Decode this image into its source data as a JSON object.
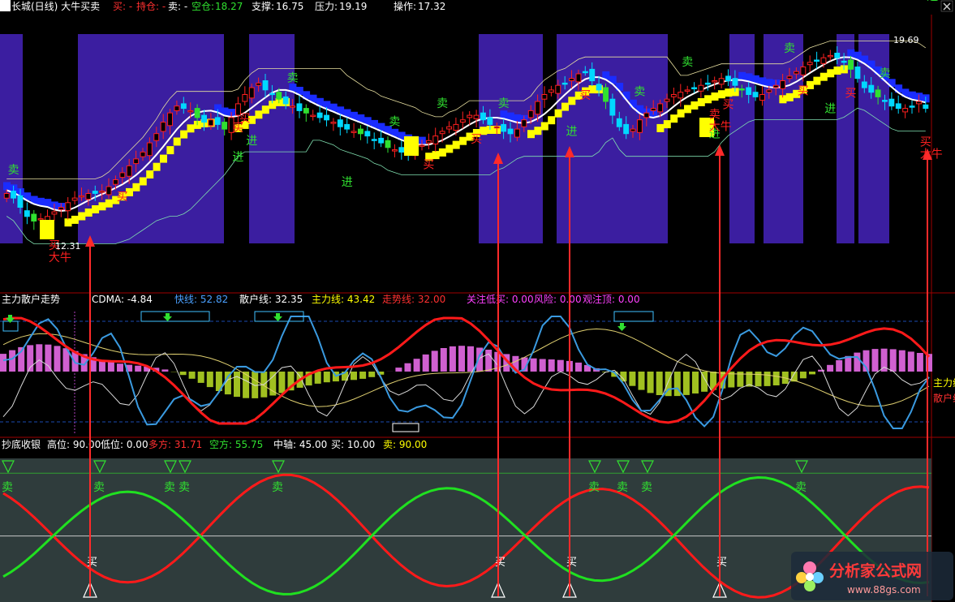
{
  "colors": {
    "up": "#ff2020",
    "down": "#00d8ff",
    "green": "#30e030",
    "yellow": "#ffff00",
    "blue": "#1a2cff",
    "purple": "#3b1ea0",
    "white": "#ffffff",
    "magenta": "#ff40ff",
    "divider": "#a00000",
    "pink": "#d060d0",
    "olive": "#a0c020",
    "panel3_bg": "#2f3c3c"
  },
  "header1": {
    "title": "深长城(日线) 大牛买卖",
    "buy": "买: -",
    "hold": "持仓: -",
    "sell": "卖: -",
    "empty_label": "空仓:",
    "empty_value": "18.27",
    "support_label": "支撑:",
    "support_value": "16.75",
    "pressure_label": "压力:",
    "pressure_value": "19.19",
    "op_label": "操作:",
    "op_value": "17.32"
  },
  "header2": {
    "title": "主力散户走势",
    "cdma": "CDMA: -4.84",
    "fast": "快线: 52.82",
    "retail": "散户线: 32.35",
    "main": "主力线: 43.42",
    "trend": "走势线: 32.00",
    "watch_low": "关注低买: 0.00",
    "risk": "风险: 0.00",
    "watch_top": "观注顶: 0.00"
  },
  "header3": {
    "title": "抄底收银",
    "high": "高位: 90.00",
    "low": "低位: 0.00",
    "long": "多方: 31.71",
    "short": "空方: 55.75",
    "axis": "中轴: 45.00",
    "buy": "买: 10.00",
    "sell": "卖: 90.00"
  },
  "panel2_right_labels": [
    "主力线",
    "散户线"
  ],
  "watermark": {
    "name": "分析家公式网",
    "url": "www.88gs.com"
  },
  "chart_data": [
    {
      "type": "candlestick",
      "title": "深长城(日线) 大牛买卖",
      "price_labels": {
        "high": "19.69",
        "low": "12.31"
      },
      "ylim": [
        11.5,
        20.6
      ],
      "sessions": 136,
      "closes": [
        13.6,
        13.4,
        13.0,
        12.6,
        12.4,
        12.5,
        12.6,
        12.8,
        13.0,
        13.2,
        13.4,
        13.5,
        13.6,
        13.6,
        13.7,
        13.9,
        14.2,
        14.5,
        14.8,
        15.1,
        15.4,
        15.8,
        16.2,
        16.7,
        17.1,
        17.4,
        17.3,
        17.2,
        16.9,
        16.7,
        16.8,
        16.6,
        16.4,
        16.9,
        17.5,
        17.9,
        18.2,
        18.4,
        18.1,
        17.9,
        17.7,
        17.5,
        17.4,
        17.2,
        17.1,
        17.0,
        16.9,
        16.8,
        16.7,
        16.5,
        16.4,
        16.3,
        16.2,
        16.1,
        15.9,
        15.8,
        15.6,
        15.5,
        15.4,
        15.4,
        15.6,
        15.7,
        15.9,
        16.1,
        16.3,
        16.5,
        16.6,
        16.8,
        17.0,
        17.0,
        16.8,
        16.6,
        16.5,
        16.3,
        16.2,
        16.4,
        16.8,
        17.2,
        17.6,
        17.9,
        18.1,
        18.3,
        18.4,
        18.6,
        18.8,
        18.9,
        18.5,
        18.1,
        17.6,
        17.0,
        16.5,
        16.2,
        16.4,
        16.8,
        17.1,
        17.3,
        17.5,
        17.7,
        17.9,
        18.0,
        18.1,
        18.2,
        18.3,
        18.4,
        18.5,
        18.6,
        18.5,
        18.3,
        18.1,
        17.9,
        17.8,
        17.9,
        18.1,
        18.3,
        18.5,
        18.7,
        18.9,
        19.1,
        19.3,
        19.4,
        19.5,
        19.6,
        19.5,
        19.3,
        19.0,
        18.6,
        18.2,
        18.0,
        17.8,
        17.6,
        17.4,
        17.3,
        17.3,
        17.4,
        17.6,
        17.3
      ],
      "signals": {
        "buy": [
          {
            "i": 17,
            "label": "买"
          },
          {
            "i": 34,
            "label": "买"
          },
          {
            "i": 35,
            "label": "买"
          },
          {
            "i": 62,
            "label": "买"
          },
          {
            "i": 69,
            "label": "买"
          },
          {
            "i": 85,
            "label": "买"
          },
          {
            "i": 106,
            "label": "买"
          },
          {
            "i": 117,
            "label": "买"
          },
          {
            "i": 124,
            "label": "买"
          }
        ],
        "sell": [
          {
            "i": 1,
            "label": "卖"
          },
          {
            "i": 42,
            "label": "卖"
          },
          {
            "i": 57,
            "label": "卖"
          },
          {
            "i": 64,
            "label": "卖"
          },
          {
            "i": 73,
            "label": "卖"
          },
          {
            "i": 93,
            "label": "卖"
          },
          {
            "i": 100,
            "label": "卖"
          },
          {
            "i": 115,
            "label": "卖"
          },
          {
            "i": 129,
            "label": "卖"
          },
          {
            "i": 140,
            "label": "卖"
          }
        ],
        "enter": [
          {
            "i": 34,
            "label": "进"
          },
          {
            "i": 36,
            "label": "进"
          },
          {
            "i": 50,
            "label": "进"
          },
          {
            "i": 83,
            "label": "进"
          },
          {
            "i": 104,
            "label": "进"
          },
          {
            "i": 121,
            "label": "进"
          },
          {
            "i": 136,
            "label": "进"
          }
        ],
        "bull": [
          {
            "i": 7,
            "label": "买\n大牛"
          },
          {
            "i": 104,
            "label": "卖\n大牛"
          },
          {
            "i": 135,
            "label": "买\n大牛"
          }
        ]
      }
    },
    {
      "type": "line",
      "title": "主力散户走势",
      "ylim": [
        -60,
        60
      ],
      "series": [
        {
          "name": "快线",
          "values": [
            52.82
          ]
        },
        {
          "name": "散户线",
          "values": [
            32.35
          ]
        },
        {
          "name": "主力线",
          "values": [
            43.42
          ]
        },
        {
          "name": "走势线",
          "values": [
            32.0
          ]
        }
      ]
    },
    {
      "type": "line",
      "title": "抄底收银",
      "ylim": [
        0,
        100
      ],
      "series": [
        {
          "name": "多方",
          "values": [
            31.71
          ]
        },
        {
          "name": "空方",
          "values": [
            55.75
          ]
        }
      ],
      "reference_lines": {
        "高位": 90,
        "中轴": 45,
        "低位": 0
      },
      "buy_marks": [
        "买",
        "买",
        "买",
        "买"
      ],
      "sell_marks": [
        "卖",
        "卖",
        "卖",
        "卖",
        "卖",
        "卖",
        "卖",
        "卖",
        "卖"
      ]
    }
  ]
}
